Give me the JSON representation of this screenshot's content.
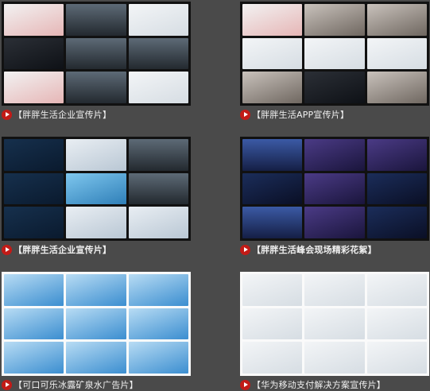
{
  "videos": [
    {
      "title": "【胖胖生活企业宣传片】",
      "bold": false,
      "style": "dark",
      "tiles": [
        "c-red",
        "c-office",
        "c-white",
        "c-dark",
        "c-office",
        "c-office",
        "c-red",
        "c-office",
        "c-white"
      ]
    },
    {
      "title": "【胖胖生活APP宣传片】",
      "bold": false,
      "style": "dark",
      "tiles": [
        "c-red",
        "c-people",
        "c-people",
        "c-white",
        "c-white",
        "c-white",
        "c-people",
        "c-dark",
        "c-people"
      ]
    },
    {
      "title": "【胖胖生活企业宣传片】",
      "bold": true,
      "style": "dark",
      "tiles": [
        "c-blue",
        "c-sky",
        "c-office",
        "c-blue",
        "c-cyan",
        "c-office",
        "c-blue",
        "c-sky",
        "c-sky"
      ]
    },
    {
      "title": "【胖胖生活峰会现场精彩花絮】",
      "bold": true,
      "style": "dark",
      "tiles": [
        "c-stage",
        "c-purple",
        "c-purple",
        "c-night",
        "c-purple",
        "c-night",
        "c-stage",
        "c-purple",
        "c-night"
      ]
    },
    {
      "title": "【可口可乐冰露矿泉水广告片】",
      "bold": false,
      "style": "light",
      "tiles": [
        "c-water",
        "c-water",
        "c-water",
        "c-water",
        "c-water",
        "c-water",
        "c-water",
        "c-water",
        "c-water"
      ]
    },
    {
      "title": "【华为移动支付解决方案宣传片】",
      "bold": false,
      "style": "light",
      "tiles": [
        "c-white",
        "c-white",
        "c-white",
        "c-white",
        "c-white",
        "c-white",
        "c-white",
        "c-white",
        "c-white"
      ]
    }
  ]
}
